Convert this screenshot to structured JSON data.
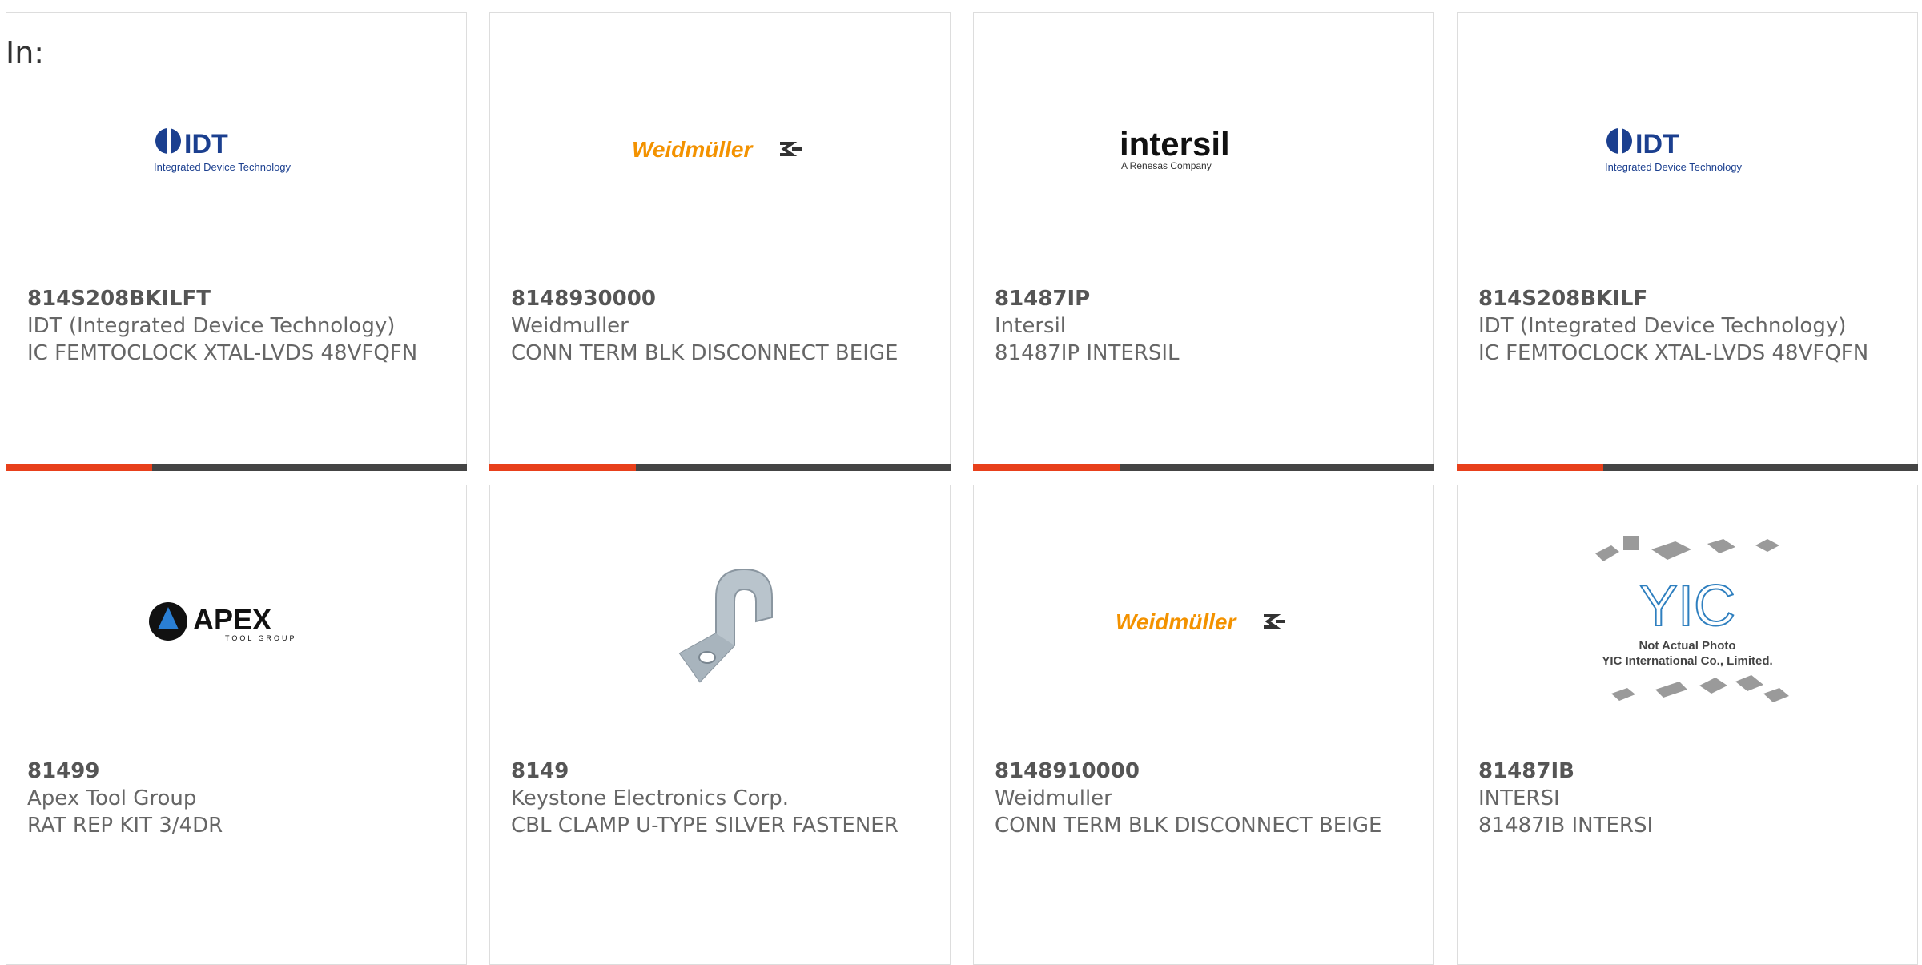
{
  "header": {
    "in_label": "In:"
  },
  "products": [
    {
      "part": "814S208BKILFT",
      "manufacturer": "IDT (Integrated Device Technology)",
      "description": "IC FEMTOCLOCK XTAL-LVDS 48VFQFN",
      "logo": "idt-logo",
      "logo_text": "IDT",
      "logo_sub": "Integrated Device Technology"
    },
    {
      "part": "8148930000",
      "manufacturer": "Weidmuller",
      "description": "CONN TERM BLK DISCONNECT BEIGE",
      "logo": "weidmuller-logo",
      "logo_text": "Weidmüller"
    },
    {
      "part": "81487IP",
      "manufacturer": "Intersil",
      "description": "81487IP INTERSIL",
      "logo": "intersil-logo",
      "logo_text": "intersil",
      "logo_sub": "A Renesas Company"
    },
    {
      "part": "814S208BKILF",
      "manufacturer": "IDT (Integrated Device Technology)",
      "description": "IC FEMTOCLOCK XTAL-LVDS 48VFQFN",
      "logo": "idt-logo",
      "logo_text": "IDT",
      "logo_sub": "Integrated Device Technology"
    },
    {
      "part": "81499",
      "manufacturer": "Apex Tool Group",
      "description": "RAT REP KIT 3/4DR",
      "logo": "apex-logo",
      "logo_text": "APEX",
      "logo_sub": "TOOL GROUP"
    },
    {
      "part": "8149",
      "manufacturer": "Keystone Electronics Corp.",
      "description": "CBL CLAMP U-TYPE SILVER FASTENER",
      "logo": "clamp-photo"
    },
    {
      "part": "8148910000",
      "manufacturer": "Weidmuller",
      "description": "CONN TERM BLK DISCONNECT BEIGE",
      "logo": "weidmuller-logo",
      "logo_text": "Weidmüller"
    },
    {
      "part": "81487IB",
      "manufacturer": "INTERSI",
      "description": "81487IB INTERSI",
      "logo": "yic-placeholder",
      "logo_text": "YIC",
      "logo_sub": "Not Actual Photo",
      "logo_sub2": "YIC International Co., Limited."
    }
  ],
  "colors": {
    "accent": "#e8401b",
    "bar": "#444444",
    "weidmuller": "#f39200",
    "idt_blue": "#1b3f8f"
  }
}
